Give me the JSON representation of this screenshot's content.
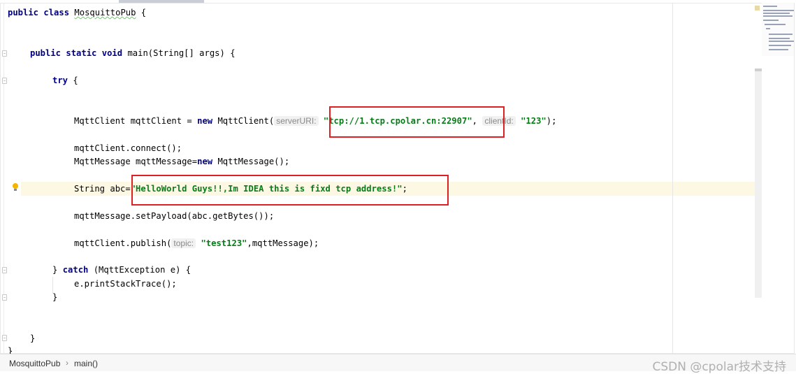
{
  "code": {
    "line_class": {
      "kw1": "public",
      "kw2": "class",
      "name": "MosquittoPub",
      "brace": " {"
    },
    "line_main": {
      "kw1": "public",
      "kw2": "static",
      "kw3": "void",
      "rest": " main(String[] args) {"
    },
    "line_try": {
      "kw": "try",
      "rest": " {"
    },
    "line_client": {
      "pre": "MqttClient mqttClient = ",
      "kw": "new",
      "mid": " MqttClient(",
      "hint1": "serverURI:",
      "str1": "\"tcp://1.tcp.cpolar.cn:22907\"",
      "comma": ",",
      "hint2": "clientId:",
      "str2": "\"123\"",
      "end": ");"
    },
    "line_connect": "mqttClient.connect();",
    "line_message": {
      "pre": "MqttMessage mqttMessage=",
      "kw": "new",
      "rest": " MqttMessage();"
    },
    "line_string": {
      "pre": "String abc=",
      "str": "\"HelloWorld Guys!!,Im IDEA this is fixd tcp address!\"",
      "end": ";"
    },
    "line_payload": "mqttMessage.setPayload(abc.getBytes());",
    "line_publish": {
      "pre": "mqttClient.publish(",
      "hint": "topic:",
      "str": "\"test123\"",
      "end": ",mqttMessage);"
    },
    "line_catch": {
      "pre": "} ",
      "kw": "catch",
      "rest": " (MqttException e) {"
    },
    "line_trace": "e.printStackTrace();",
    "line_close_catch": "}",
    "line_close_main": "}",
    "line_close_class": "}"
  },
  "statusbar": {
    "crumb_class": "MosquittoPub",
    "crumb_method": "main()",
    "separator": "›"
  },
  "watermark": "CSDN @cpolar技术支持",
  "colors": {
    "keyword": "#000080",
    "string": "#067d17",
    "annotation_box": "#e02020",
    "current_line": "#fdf8e4"
  }
}
